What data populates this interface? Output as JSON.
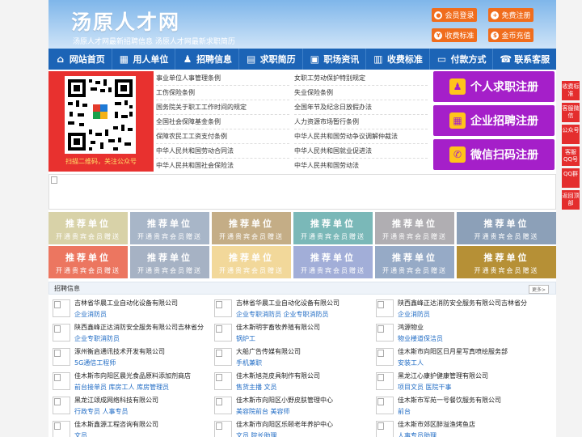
{
  "header": {
    "logo": "汤原人才网",
    "tagline": "汤原人才网最新招聘信息   汤原人才网最新求职简历",
    "buttons": [
      {
        "label": "会员登录",
        "icon": "user-icon"
      },
      {
        "label": "免费注册",
        "icon": "user-add-icon"
      },
      {
        "label": "收费标准",
        "icon": "yen-icon"
      },
      {
        "label": "金币充值",
        "icon": "coin-icon"
      }
    ]
  },
  "nav": [
    {
      "label": "网站首页",
      "icon": "home-icon"
    },
    {
      "label": "用人单位",
      "icon": "building-icon"
    },
    {
      "label": "招聘信息",
      "icon": "people-icon"
    },
    {
      "label": "求职简历",
      "icon": "resume-icon"
    },
    {
      "label": "职场资讯",
      "icon": "news-icon"
    },
    {
      "label": "收费标准",
      "icon": "yen-icon"
    },
    {
      "label": "付款方式",
      "icon": "card-icon"
    },
    {
      "label": "联系客服",
      "icon": "phone-icon"
    }
  ],
  "qr_caption": "扫描二维码，关注公众号",
  "links": [
    "事业单位人事管理条例",
    "女职工劳动保护特别规定",
    "工伤保险条例",
    "失业保险条例",
    "国务院关于职工工作时间的规定",
    "全国年节及纪念日放假办法",
    "全国社会保障基金条例",
    "人力资源市场暂行条例",
    "保障农民工工资支付条例",
    "中华人民共和国劳动争议调解仲裁法",
    "中华人民共和国劳动合同法",
    "中华人民共和国就业促进法",
    "中华人民共和国社会保险法",
    "中华人民共和国劳动法"
  ],
  "register": [
    {
      "label": "个人求职注册",
      "icon": "person-icon"
    },
    {
      "label": "企业招聘注册",
      "icon": "company-icon"
    },
    {
      "label": "微信扫码注册",
      "icon": "wechat-icon"
    }
  ],
  "tiles": {
    "title": "推荐单位",
    "subtitle": "开通贵宾会员赠送",
    "colors": [
      "#d8d2a8",
      "#a8b6c8",
      "#c4ad86",
      "#7ab8b8",
      "#b0aeb2",
      "#8ca0b8",
      "#ec7660",
      "#a6b2c4",
      "#f2d89a",
      "#a2aed8",
      "#96aac6",
      "#b69036"
    ]
  },
  "recruit": {
    "title": "招聘信息",
    "more": "更多>",
    "jobs": [
      {
        "company": "吉林省华晨工业自动化设备有限公司",
        "positions": "企业消防员"
      },
      {
        "company": "吉林省华晨工业自动化设备有限公司",
        "positions": "企业专职消防员  企业专职消防员"
      },
      {
        "company": "陕西鑫峰正达消防安全服务有限公司吉林省分",
        "positions": "企业消防员"
      },
      {
        "company": "陕西鑫峰正达消防安全服务有限公司吉林省分",
        "positions": "企业专职消防员"
      },
      {
        "company": "佳木斯明宇畜牧养殖有限公司",
        "positions": "锅炉工"
      },
      {
        "company": "鸿源物业",
        "positions": "物业楼道保洁员"
      },
      {
        "company": "涿州衡启通讯技术开发有限公司",
        "positions": "5G通信工程师"
      },
      {
        "company": "大船广告传媒有限公司",
        "positions": "手机兼职"
      },
      {
        "company": "佳木斯市向阳区日月星写真喷绘服务部",
        "positions": "安装工人"
      },
      {
        "company": "佳木斯市向阳区晨光食品原料添加剂商店",
        "positions": "前台接单员  库房工人  库房管理员"
      },
      {
        "company": "佳木斯旭尧皮具制作有限公司",
        "positions": "售货主播  文员"
      },
      {
        "company": "黑龙江心康护健康管理有限公司",
        "positions": "项目文员  医院干事"
      },
      {
        "company": "黑龙江颂成网络科技有限公司",
        "positions": "行政专员  人事专员"
      },
      {
        "company": "佳木斯市向阳区小野皮肤管理中心",
        "positions": "美容院前台  美容师"
      },
      {
        "company": "佳木斯市军苑一号餐饮服务有限公司",
        "positions": "前台"
      },
      {
        "company": "佳木斯鑫源工程咨询有限公司",
        "positions": "文员"
      },
      {
        "company": "佳木斯市向阳区乐颐老年养护中心",
        "positions": "文员  院长助理"
      },
      {
        "company": "佳木斯市郊区醉溢渔烤鱼店",
        "positions": "人事专员助理"
      }
    ]
  },
  "side": [
    "收费标准",
    "客服微信",
    "公众号",
    "客服QQ号",
    "QQ群",
    "返回顶部"
  ]
}
